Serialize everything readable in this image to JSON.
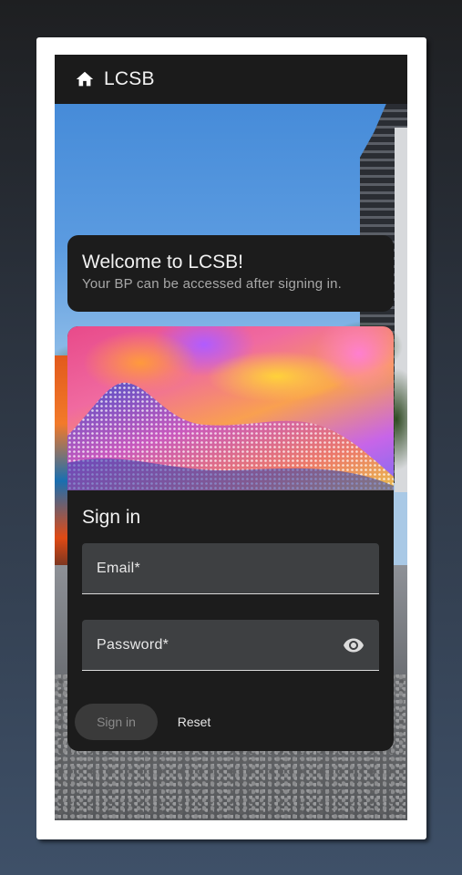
{
  "appbar": {
    "title": "LCSB",
    "home_icon": "home-icon"
  },
  "welcome": {
    "title": "Welcome to LCSB!",
    "subtitle": "Your BP can be accessed after signing in."
  },
  "signin": {
    "title": "Sign in",
    "email_label": "Email*",
    "email_value": "",
    "password_label": "Password*",
    "password_value": "",
    "visibility_icon": "eye-icon",
    "signin_button": "Sign in",
    "reset_button": "Reset"
  },
  "colors": {
    "appbar_bg": "#1b1b1b",
    "card_bg": "#1c1c1c",
    "field_bg": "#3e4042",
    "disabled_button_bg": "#3a3a3a"
  }
}
